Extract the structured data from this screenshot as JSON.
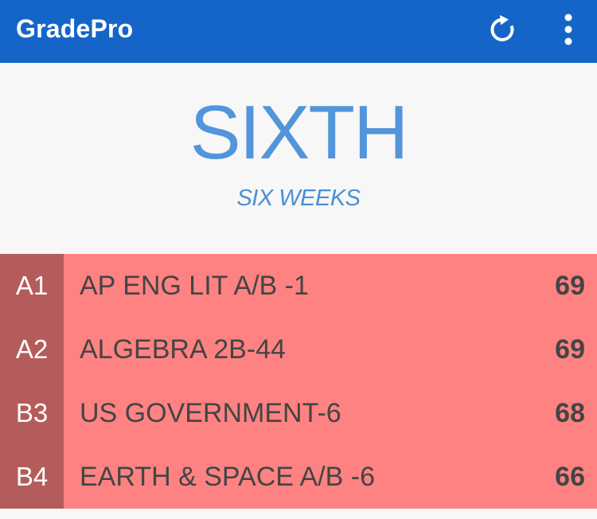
{
  "app": {
    "title": "GradePro",
    "colors": {
      "appbar": "#1565c8",
      "accent_text": "#4a90d9",
      "row_background": "#ff8282",
      "period_background": "#b45c5c"
    }
  },
  "toolbar": {
    "refresh_icon": "refresh-icon",
    "more_icon": "more-vertical-icon"
  },
  "header": {
    "period_title": "SIXTH",
    "period_subtitle": "SIX WEEKS"
  },
  "courses": [
    {
      "period": "A1",
      "name": "AP ENG LIT A/B -1",
      "grade": "69"
    },
    {
      "period": "A2",
      "name": "ALGEBRA 2B-44",
      "grade": "69"
    },
    {
      "period": "B3",
      "name": "US GOVERNMENT-6",
      "grade": "68"
    },
    {
      "period": "B4",
      "name": "EARTH & SPACE A/B -6",
      "grade": "66"
    }
  ]
}
